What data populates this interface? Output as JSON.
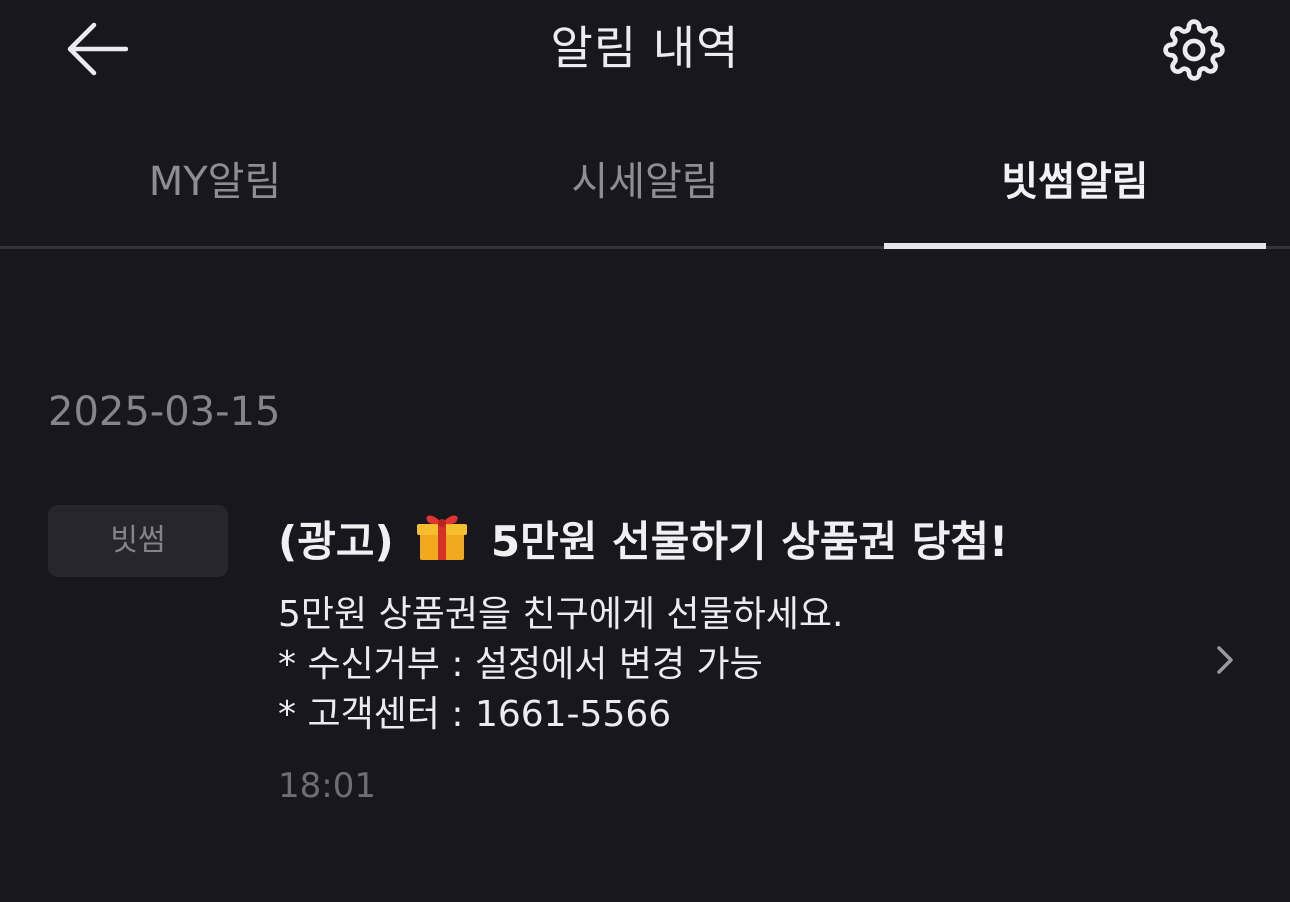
{
  "header": {
    "title": "알림 내역",
    "back_icon": "arrow-left-icon",
    "settings_icon": "gear-icon"
  },
  "tabs": [
    {
      "label": "MY알림",
      "active": false
    },
    {
      "label": "시세알림",
      "active": false
    },
    {
      "label": "빗썸알림",
      "active": true
    }
  ],
  "date_group": "2025-03-15",
  "notification": {
    "badge": "빗썸",
    "title_prefix": "(광고)",
    "title_icon": "gift-icon",
    "title_text": "5만원 선물하기 상품권 당첨!",
    "body_lines": [
      "5만원 상품권을 친구에게 선물하세요.",
      "* 수신거부 : 설정에서 변경 가능",
      "* 고객센터 : 1661-5566"
    ],
    "time": "18:01",
    "chevron_icon": "chevron-right-icon"
  },
  "colors": {
    "background": "#18171d",
    "badge_bg": "#27262d",
    "active_tab": "#f2f2f5",
    "inactive_tab": "#8e8d94"
  }
}
